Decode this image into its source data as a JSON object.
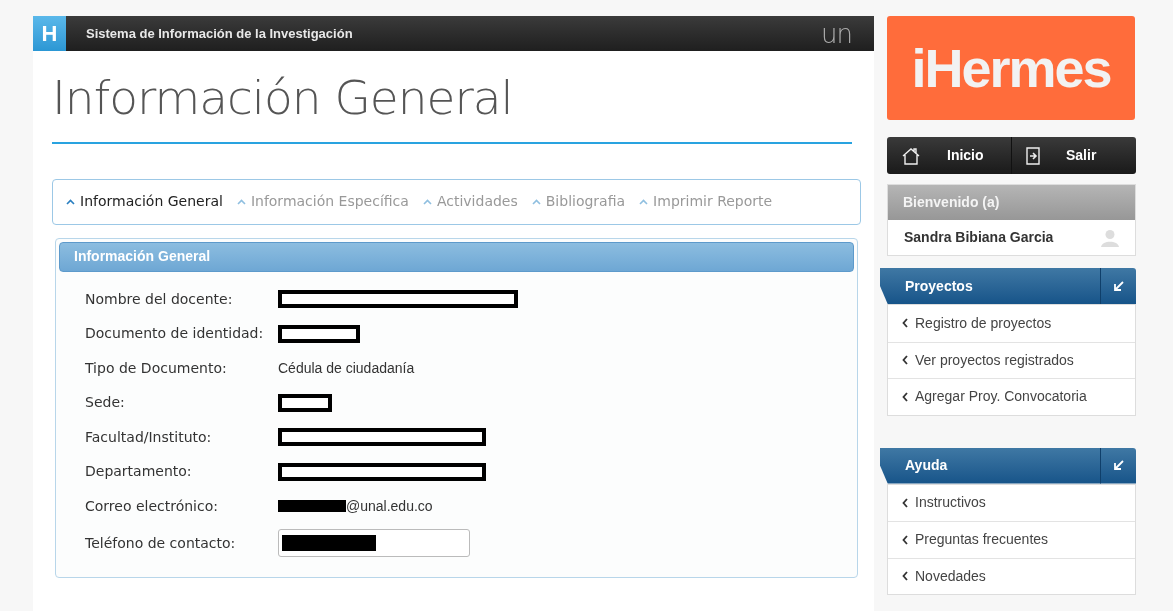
{
  "header": {
    "badge": "H",
    "title": "Sistema de Información de la Investigación",
    "mark": "un"
  },
  "page_title": "Información General",
  "tabs": [
    {
      "label": "Información General",
      "selected": true
    },
    {
      "label": "Información Específica",
      "selected": false
    },
    {
      "label": "Actividades",
      "selected": false
    },
    {
      "label": "Bibliografia",
      "selected": false
    },
    {
      "label": "Imprimir Reporte",
      "selected": false
    }
  ],
  "panel": {
    "title": "Información General",
    "fields": [
      {
        "label": "Nombre del docente:",
        "kind": "redacted"
      },
      {
        "label": "Documento de identidad:",
        "kind": "redacted"
      },
      {
        "label": "Tipo de Documento:",
        "kind": "text",
        "value": "Cédula de ciudadanía"
      },
      {
        "label": "Sede:",
        "kind": "redacted"
      },
      {
        "label": "Facultad/Instituto:",
        "kind": "redacted"
      },
      {
        "label": "Departamento:",
        "kind": "redacted"
      },
      {
        "label": "Correo electrónico:",
        "kind": "email",
        "value": "@unal.edu.co"
      },
      {
        "label": "Teléfono de contacto:",
        "kind": "input"
      }
    ]
  },
  "sidebar": {
    "logo": "iHermes",
    "nav": [
      "Inicio",
      "Salir"
    ],
    "welcome": {
      "title": "Bienvenido (a)",
      "user": "Sandra Bibiana Garcia"
    },
    "sections": [
      {
        "title": "Proyectos",
        "items": [
          "Registro de proyectos",
          "Ver proyectos registrados",
          "Agregar Proy. Convocatoria"
        ]
      },
      {
        "title": "Ayuda",
        "items": [
          "Instructivos",
          "Preguntas frecuentes",
          "Novedades"
        ]
      }
    ]
  }
}
